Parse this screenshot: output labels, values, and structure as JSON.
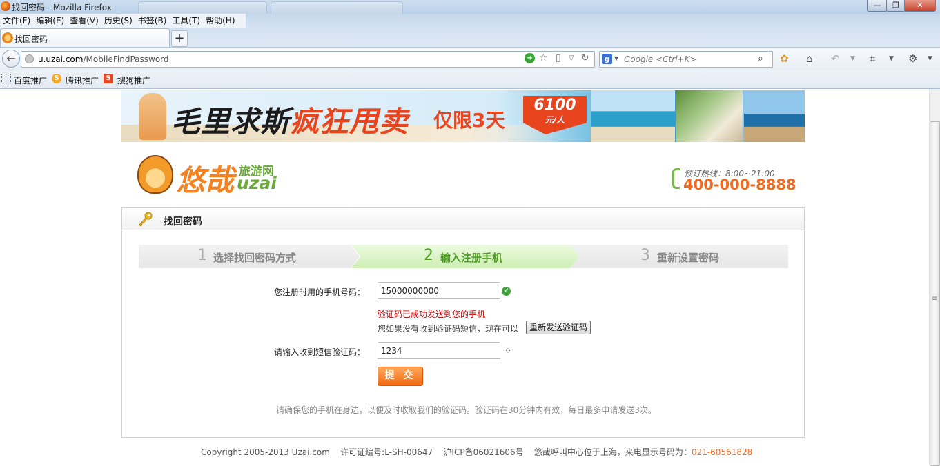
{
  "window": {
    "title": "找回密码 - Mozilla Firefox",
    "controls": [
      "—",
      "❐",
      "✕"
    ]
  },
  "menu": [
    "文件(F)",
    "编辑(E)",
    "查看(V)",
    "历史(S)",
    "书签(B)",
    "工具(T)",
    "帮助(H)"
  ],
  "tab": {
    "label": "找回密码",
    "new_tab": "+"
  },
  "url": {
    "domain": "u.uzai.com",
    "path": "/MobileFindPassword"
  },
  "search": {
    "engine": "g",
    "placeholder": "Google <Ctrl+K>"
  },
  "bookmarks": [
    {
      "label": "百度推广",
      "icon": "dotted-page-icon"
    },
    {
      "label": "腾讯推广",
      "icon": "tencent-s-icon"
    },
    {
      "label": "搜狗推广",
      "icon": "sogou-s-icon"
    }
  ],
  "banner": {
    "title_a": "毛里求斯",
    "title_b": "疯狂甩卖",
    "limit": "仅限3天",
    "price": "6100",
    "price_unit": "元/人"
  },
  "logo": {
    "cn": "悠哉",
    "sub_cn": "旅游网",
    "sub_en": "uzai"
  },
  "hotline": {
    "label": "预订热线：8:00~21:00",
    "number": "400-000-8888"
  },
  "panel": {
    "title": "找回密码"
  },
  "steps": [
    {
      "num": "1",
      "label": "选择找回密码方式",
      "active": false
    },
    {
      "num": "2",
      "label": "输入注册手机",
      "active": true
    },
    {
      "num": "3",
      "label": "重新设置密码",
      "active": false
    }
  ],
  "form": {
    "phone_label": "您注册时用的手机号码：",
    "phone_value": "15000000000",
    "sent_msg": "验证码已成功发送到您的手机",
    "resend_text": "您如果没有收到验证码短信，现在可以",
    "resend_button": "重新发送验证码",
    "code_label": "请输入收到短信验证码：",
    "code_value": "1234",
    "submit": "提 交"
  },
  "note": "请确保您的手机在身边，以便及时收取我们的验证码。验证码在30分钟内有效，每日最多申请发送3次。",
  "footer": {
    "copyright": "Copyright 2005-2013 Uzai.com",
    "license": "许可证编号:L-SH-00647",
    "icp": "沪ICP备06021606号",
    "callcenter": "悠哉呼叫中心位于上海，来电显示号码为：",
    "tel": "021-60561828"
  },
  "colors": {
    "accent_orange": "#f16a1d",
    "step_active_green": "#4c9e1f",
    "error_red": "#cc0000"
  }
}
